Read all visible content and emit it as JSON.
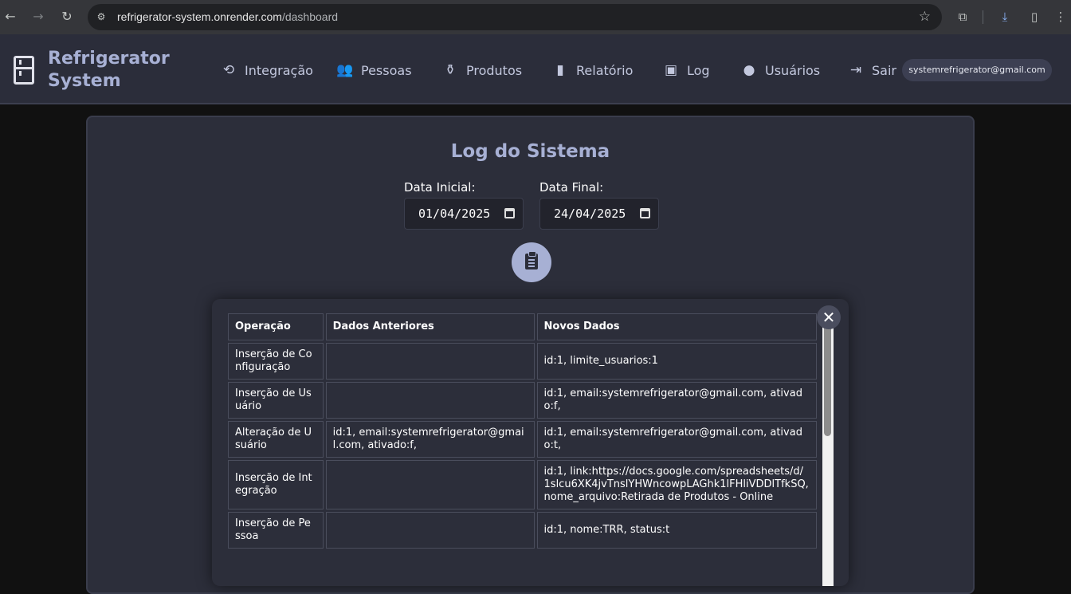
{
  "browser": {
    "url_host": "refrigerator-system.onrender.com",
    "url_path": "/dashboard"
  },
  "header": {
    "brand_line1": "Refrigerator",
    "brand_line2": "System",
    "nav": [
      {
        "label": "Integração",
        "icon": "sync-icon"
      },
      {
        "label": "Pessoas",
        "icon": "people-icon"
      },
      {
        "label": "Produtos",
        "icon": "bottles-icon"
      },
      {
        "label": "Relatório",
        "icon": "bar-chart-icon"
      },
      {
        "label": "Log",
        "icon": "log-chart-icon"
      },
      {
        "label": "Usuários",
        "icon": "person-icon"
      },
      {
        "label": "Sair",
        "icon": "logout-icon"
      }
    ],
    "user_email": "systemrefrigerator@gmail.com"
  },
  "page": {
    "title": "Log do Sistema",
    "start_label": "Data Inicial:",
    "start_value": "01/04/2025",
    "end_label": "Data Final:",
    "end_value": "24/04/2025"
  },
  "log_table": {
    "columns": [
      "Operação",
      "Dados Anteriores",
      "Novos Dados"
    ],
    "rows": [
      {
        "op": "Inserção de Configuração",
        "prev": "",
        "new": "id:1, limite_usuarios:1"
      },
      {
        "op": "Inserção de Usuário",
        "prev": "",
        "new": "id:1, email:systemrefrigerator@gmail.com, ativado:f,"
      },
      {
        "op": "Alteração de Usuário",
        "prev": "id:1, email:systemrefrigerator@gmail.com, ativado:f,",
        "new": "id:1, email:systemrefrigerator@gmail.com, ativado:t,"
      },
      {
        "op": "Inserção de Integração",
        "prev": "",
        "new": "id:1, link:https://docs.google.com/spreadsheets/d/1slcu6XK4jvTnslYHWncowpLAGhk1lFHliVDDlTfkSQ, nome_arquivo:Retirada de Produtos - Online"
      },
      {
        "op": "Inserção de Pessoa",
        "prev": "",
        "new": "id:1, nome:TRR, status:t"
      }
    ]
  }
}
